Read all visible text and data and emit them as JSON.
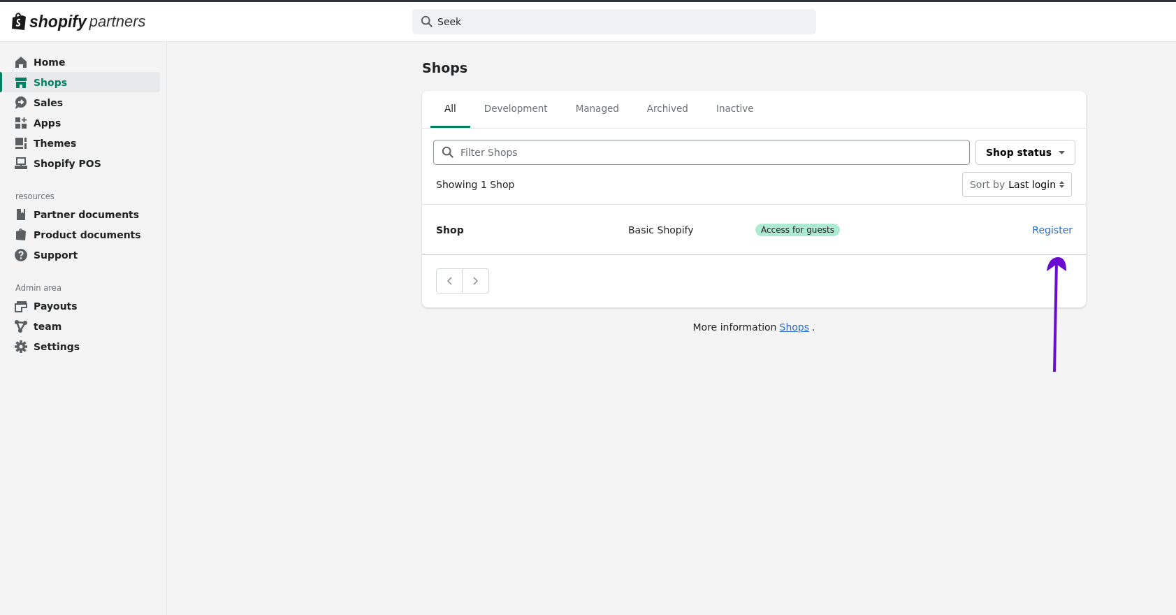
{
  "logo": {
    "brand": "shopify",
    "product": "partners"
  },
  "search": {
    "placeholder": "Seek"
  },
  "sidebar": {
    "sections": [
      {
        "items": [
          {
            "label": "Home",
            "selected": false
          },
          {
            "label": "Shops",
            "selected": true
          },
          {
            "label": "Sales",
            "selected": false
          },
          {
            "label": "Apps",
            "selected": false
          },
          {
            "label": "Themes",
            "selected": false
          },
          {
            "label": "Shopify POS",
            "selected": false
          }
        ]
      },
      {
        "heading": "resources",
        "items": [
          {
            "label": "Partner documents",
            "selected": false
          },
          {
            "label": "Product documents",
            "selected": false
          },
          {
            "label": "Support",
            "selected": false
          }
        ]
      },
      {
        "heading": "Admin area",
        "items": [
          {
            "label": "Payouts",
            "selected": false
          },
          {
            "label": "team",
            "selected": false
          },
          {
            "label": "Settings",
            "selected": false
          }
        ]
      }
    ]
  },
  "page_title": "Shops",
  "tabs": [
    {
      "label": "All",
      "selected": true
    },
    {
      "label": "Development",
      "selected": false
    },
    {
      "label": "Managed",
      "selected": false
    },
    {
      "label": "Archived",
      "selected": false
    },
    {
      "label": "Inactive",
      "selected": false
    }
  ],
  "filter": {
    "placeholder": "Filter Shops",
    "status_button": "Shop status"
  },
  "showing": "Showing 1 Shop",
  "sort": {
    "prefix": "Sort by",
    "value": "Last login"
  },
  "rows": [
    {
      "name": "Shop",
      "plan": "Basic Shopify",
      "badge": "Access for guests",
      "action": "Register"
    }
  ],
  "footer": {
    "text": "More information",
    "link": "Shops",
    "end": "."
  }
}
